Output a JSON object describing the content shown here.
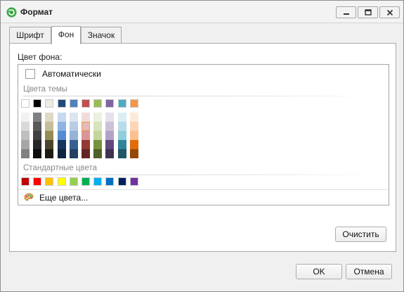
{
  "window": {
    "title": "Формат",
    "app_icon": "refresh-icon"
  },
  "title_controls": {
    "minimize": "minimize-icon",
    "maximize": "maximize-icon",
    "close": "close-icon"
  },
  "tabs": [
    {
      "label": "Шрифт",
      "active": false
    },
    {
      "label": "Фон",
      "active": true
    },
    {
      "label": "Значок",
      "active": false
    }
  ],
  "panel": {
    "section_label": "Цвет фона:",
    "picker": {
      "automatic_label": "Автоматически",
      "theme_label": "Цвета темы",
      "standard_label": "Стандартные цвета",
      "more_colors_label": "Еще цвета...",
      "more_colors_icon": "palette-icon",
      "theme_base": [
        "#ffffff",
        "#000000",
        "#eeece1",
        "#1f497d",
        "#4f81bd",
        "#c0504d",
        "#9bbb59",
        "#8064a2",
        "#4bacc6",
        "#f79646"
      ],
      "theme_tones": [
        [
          "#f2f2f2",
          "#d9d9d9",
          "#bfbfbf",
          "#a6a6a6",
          "#808080"
        ],
        [
          "#808080",
          "#595959",
          "#404040",
          "#262626",
          "#0d0d0d"
        ],
        [
          "#ddd9c4",
          "#c4bd97",
          "#948b54",
          "#4a452a",
          "#1e1c11"
        ],
        [
          "#c6d9f0",
          "#8db3e2",
          "#548dd4",
          "#17365d",
          "#0f243e"
        ],
        [
          "#dbe5f1",
          "#b8cce4",
          "#95b3d7",
          "#366092",
          "#244061"
        ],
        [
          "#f2dcdb",
          "#e6b9b8",
          "#d99694",
          "#953734",
          "#632523"
        ],
        [
          "#ebf1dd",
          "#d7e3bc",
          "#c3d69b",
          "#76923c",
          "#4f6128"
        ],
        [
          "#e5e0ec",
          "#ccc1d9",
          "#b2a2c7",
          "#5f497a",
          "#3f3151"
        ],
        [
          "#dbeef3",
          "#b7dde8",
          "#92cddc",
          "#31859b",
          "#205867"
        ],
        [
          "#fdeada",
          "#fbd5b5",
          "#fac08f",
          "#e36c09",
          "#974806"
        ]
      ],
      "selected_tone": {
        "column": 5,
        "row": 1
      },
      "standard": [
        "#c00000",
        "#ff0000",
        "#ffc000",
        "#ffff00",
        "#92d050",
        "#00b050",
        "#00b0f0",
        "#0070c0",
        "#002060",
        "#7030a0"
      ]
    },
    "clear_button": "Очистить"
  },
  "footer": {
    "ok_button": "OK",
    "cancel_button": "Отмена"
  }
}
